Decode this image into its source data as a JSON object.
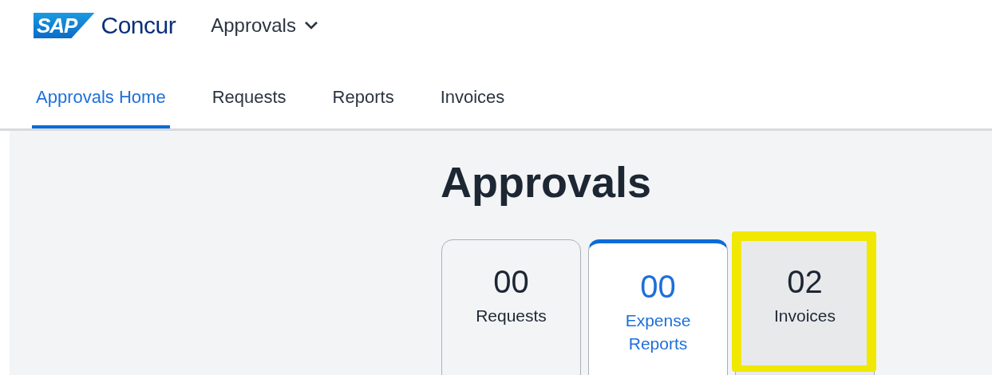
{
  "header": {
    "logo": {
      "mark": "SAP",
      "name": "Concur"
    },
    "app_menu": {
      "label": "Approvals"
    }
  },
  "tabs": [
    {
      "label": "Approvals Home",
      "selected": true
    },
    {
      "label": "Requests",
      "selected": false
    },
    {
      "label": "Reports",
      "selected": false
    },
    {
      "label": "Invoices",
      "selected": false
    }
  ],
  "page_title": "Approvals",
  "cards": [
    {
      "count": "00",
      "label": "Requests",
      "selected": false,
      "highlighted": false,
      "kind": "plain"
    },
    {
      "count": "00",
      "label": "Expense Reports",
      "selected": true,
      "highlighted": false,
      "kind": "plain"
    },
    {
      "count": "02",
      "label": "Invoices",
      "selected": false,
      "highlighted": true,
      "kind": "shaded"
    }
  ]
}
